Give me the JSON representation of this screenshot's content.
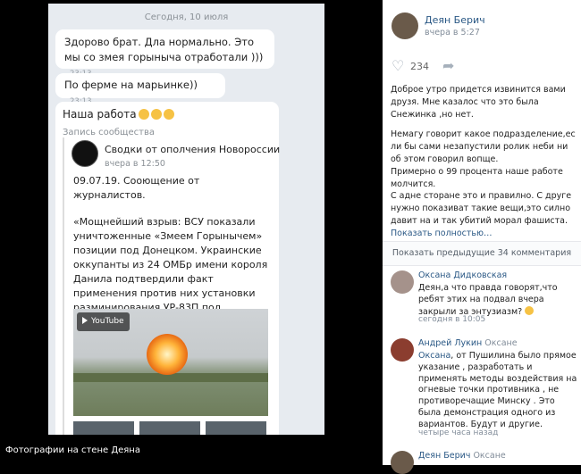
{
  "chat": {
    "date_divider": "Сегодня, 10 июля",
    "messages": [
      {
        "text": "Здорово брат. Дла нормально. Это мы со змея горыныча отработали )))",
        "time": "23:13"
      },
      {
        "text": "По ферме на марьинке))",
        "time": "23:13"
      }
    ],
    "post_message": {
      "text": "Наша работа",
      "note": "Запись сообщества",
      "repost": {
        "source_name": "Сводки от ополчения Новороссии",
        "time": "вчера в 12:50",
        "p1": "09.07.19. Сооющение от журналистов.",
        "p2": "«Мощнейший взрыв: ВСУ показали уничтоженные «Змеем Горынычем» позиции под Донецком. Украинские оккупанты из 24 ОМБр имени короля Данила подтвердили факт применения против них установки разминирования УР-83П под Донецком, о чём ранее сообщала «Русская Весна». «Взрыв, экв...",
        "video_badge": "YouTube"
      }
    }
  },
  "caption": "Фотографии на стене Деяна",
  "post": {
    "author": "Деян Берич",
    "time": "вчера в 5:27",
    "likes": "234",
    "p1": "Доброе утро придется извинится вами друзя. Мне казалос что это была Снежинка ,но нет.",
    "p2": "Немагу говорит какое подразделение,ес ли бы сами незапустили ролик неби ни об этом говорил вопще.",
    "p3": "Примерно о 99 процента наше работе молчится.",
    "p4": "С адне сторане это и правилно. С другe нужно показиват такие вещи,это силно давит на и так убитий морал фашиста.",
    "show_more": "Показать полностью…"
  },
  "comments_header": "Показать предыдущие 34 комментария",
  "comments": [
    {
      "author": "Оксана Дидковская",
      "text": "Деян,а что правда говорят,что ребят этих на подвал вчера закрыли за энтузиазм?",
      "date": "сегодня в 10:05"
    },
    {
      "author": "Андрей Лукин",
      "reply_to": "Оксане",
      "addressee": "Оксана",
      "text": ", от Пушилина было прямое указание , разработать и применять методы воздействия на огневые точки противника , не противоречащие Минску . Это была демонстрация одного из вариантов. Будут и другие.",
      "date": "четыре часа назад"
    },
    {
      "author": "Деян Берич",
      "reply_to": "Оксане"
    }
  ],
  "colors": {
    "link": "#2a5885",
    "chat_bg": "#e7ebf0",
    "muted": "#818c99"
  }
}
